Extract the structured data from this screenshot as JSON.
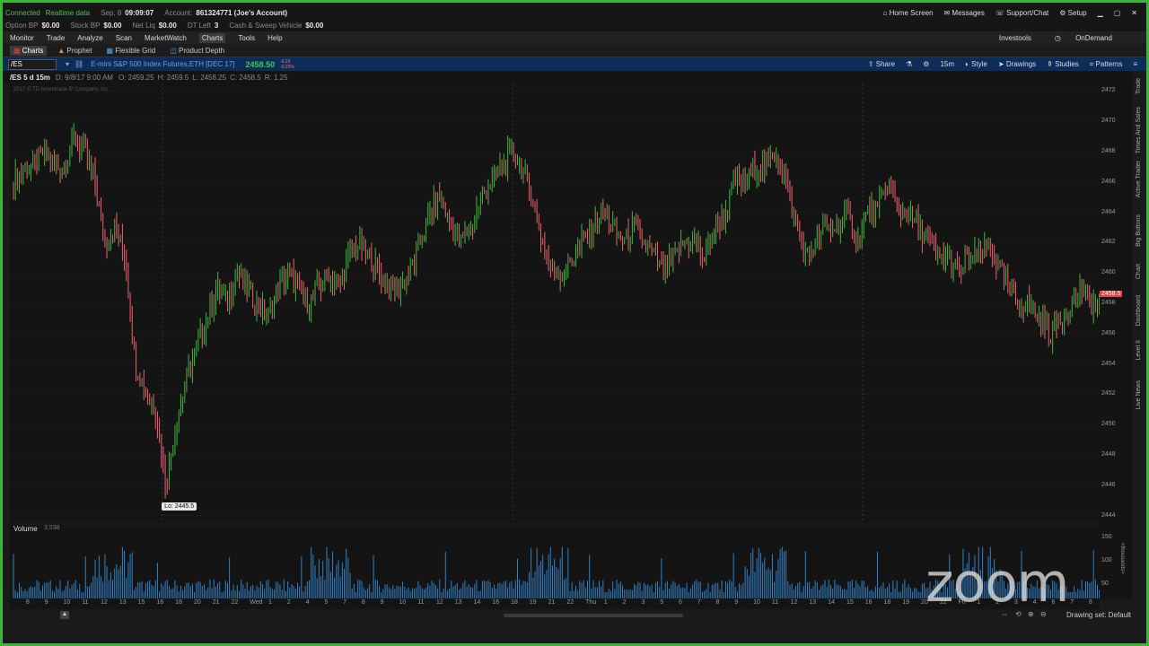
{
  "status_bar": {
    "connected": "Connected",
    "realtime": "Realtime data",
    "date": "Sep, 8",
    "time": "09:09:07",
    "account_label": "Account:",
    "account_value": "861324771 (Joe's Account)",
    "home_screen": "Home Screen",
    "messages": "Messages",
    "support": "Support/Chat",
    "setup": "Setup"
  },
  "balances": [
    {
      "label": "Option BP",
      "value": "$0.00"
    },
    {
      "label": "Stock BP",
      "value": "$0.00"
    },
    {
      "label": "Net Liq",
      "value": "$0.00"
    },
    {
      "label": "DT Left",
      "value": "3"
    },
    {
      "label": "Cash & Sweep Vehicle",
      "value": "$0.00"
    }
  ],
  "main_menu": [
    "Monitor",
    "Trade",
    "Analyze",
    "Scan",
    "MarketWatch",
    "Charts",
    "Tools",
    "Help"
  ],
  "main_menu_right": {
    "investools": "Investools",
    "ondemand": "OnDemand"
  },
  "sub_tabs": [
    "Charts",
    "Prophet",
    "Flexible Grid",
    "Product Depth"
  ],
  "symbol_bar": {
    "symbol": "/ES",
    "description": "E-mini S&P 500 Index Futures,ETH [DEC 17]",
    "last": "2458.50",
    "change": "-6.25",
    "change_pct": "-0.25%",
    "share": "Share",
    "interval": "15m",
    "style": "Style",
    "drawings": "Drawings",
    "studies": "Studies",
    "patterns": "Patterns"
  },
  "chart_header": {
    "period": "/ES 5 d 15m",
    "info": "D: 9/8/17 9:00 AM",
    "open": "O: 2459.25",
    "high": "H: 2459.5",
    "low": "L: 2458.25",
    "close": "C: 2458.5",
    "range": "R: 1.25",
    "copyright": "2017 © TD Ameritrade IP Company, Inc."
  },
  "lo_label": "Lo: 2445.5",
  "price_tag": "2458.5",
  "volume_header": {
    "label": "Volume",
    "value": "3,538"
  },
  "volume_axis": [
    "150",
    "100",
    "50"
  ],
  "volume_unit": "<thousands>",
  "y_ticks": [
    "2472",
    "2470",
    "2468",
    "2466",
    "2464",
    "2462",
    "2460",
    "2458",
    "2456",
    "2454",
    "2452",
    "2450",
    "2448",
    "2446",
    "2444"
  ],
  "x_ticks": [
    "8",
    "9",
    "10",
    "11",
    "12",
    "13",
    "15",
    "16",
    "18",
    "20",
    "21",
    "22",
    "Wed",
    "1",
    "2",
    "4",
    "5",
    "7",
    "8",
    "9",
    "10",
    "11",
    "12",
    "13",
    "14",
    "16",
    "18",
    "19",
    "21",
    "22",
    "Thu",
    "1",
    "2",
    "3",
    "5",
    "6",
    "7",
    "8",
    "9",
    "10",
    "11",
    "12",
    "13",
    "14",
    "15",
    "16",
    "18",
    "19",
    "20",
    "22",
    "Fri",
    "1",
    "2",
    "3",
    "4",
    "6",
    "7",
    "8"
  ],
  "sidebar": [
    "Trade",
    "Times And Sales",
    "Active Trader",
    "Big Buttons",
    "Chart",
    "Dashboard",
    "Level II",
    "Live News"
  ],
  "drawing_set": "Drawing set: Default",
  "watermark": "zoom",
  "colors": {
    "up": "#3cba3c",
    "down": "#f06070",
    "accent": "#3fb43a",
    "volume": "#2f82c7"
  },
  "chart_data": {
    "type": "candlestick",
    "series": [
      {
        "name": "/ES 15m",
        "values": [
          2466,
          2467,
          2467,
          2468,
          2467,
          2467,
          2469,
          2468,
          2466,
          2462,
          2463,
          2461,
          2454,
          2452,
          2451,
          2446,
          2450,
          2453,
          2455,
          2457,
          2459,
          2458,
          2460,
          2459,
          2458,
          2457,
          2459,
          2460,
          2459,
          2458,
          2459,
          2460,
          2459,
          2461,
          2462,
          2461,
          2460,
          2459,
          2459,
          2460,
          2462,
          2464,
          2465,
          2463,
          2462,
          2463,
          2465,
          2466,
          2467,
          2468,
          2467,
          2465,
          2462,
          2460,
          2460,
          2461,
          2462,
          2463,
          2464,
          2463,
          2462,
          2463,
          2462,
          2461,
          2460,
          2461,
          2462,
          2462,
          2461,
          2463,
          2464,
          2466,
          2466,
          2467,
          2467,
          2468,
          2466,
          2463,
          2461,
          2462,
          2463,
          2463,
          2464,
          2462,
          2464,
          2464,
          2466,
          2464,
          2464,
          2463,
          2462,
          2461,
          2461,
          2460,
          2461,
          2461,
          2462,
          2460,
          2459,
          2458,
          2458,
          2457,
          2456,
          2457,
          2458,
          2459,
          2458,
          2458
        ]
      }
    ],
    "ylim": [
      2443.5,
      2472.5
    ]
  }
}
